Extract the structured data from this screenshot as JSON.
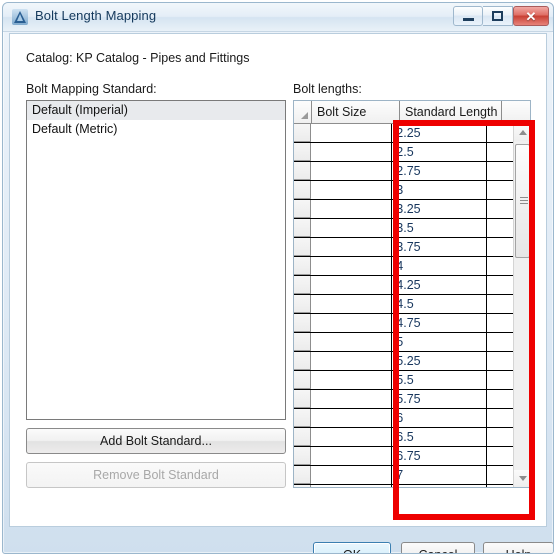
{
  "window": {
    "title": "Bolt Length Mapping",
    "icon": "autocad-triangle-icon",
    "controls": {
      "minimize": "minimize-icon",
      "maximize": "maximize-icon",
      "close": "✕"
    }
  },
  "catalog": {
    "label": "Catalog: KP Catalog - Pipes and Fittings"
  },
  "standards": {
    "label": "Bolt Mapping Standard:",
    "items": [
      {
        "label": "Default (Imperial)",
        "selected": true
      },
      {
        "label": "Default (Metric)",
        "selected": false
      }
    ],
    "add_button": "Add Bolt Standard...",
    "remove_button": "Remove Bolt Standard",
    "remove_enabled": false
  },
  "lengths": {
    "label": "Bolt lengths:",
    "columns": [
      "Bolt Size",
      "Standard Length"
    ],
    "rows": [
      {
        "bolt_size": "",
        "standard_length": "2.25"
      },
      {
        "bolt_size": "",
        "standard_length": "2.5"
      },
      {
        "bolt_size": "",
        "standard_length": "2.75"
      },
      {
        "bolt_size": "",
        "standard_length": "3"
      },
      {
        "bolt_size": "",
        "standard_length": "3.25"
      },
      {
        "bolt_size": "",
        "standard_length": "3.5"
      },
      {
        "bolt_size": "",
        "standard_length": "3.75"
      },
      {
        "bolt_size": "",
        "standard_length": "4"
      },
      {
        "bolt_size": "",
        "standard_length": "4.25"
      },
      {
        "bolt_size": "",
        "standard_length": "4.5"
      },
      {
        "bolt_size": "",
        "standard_length": "4.75"
      },
      {
        "bolt_size": "",
        "standard_length": "5"
      },
      {
        "bolt_size": "",
        "standard_length": "5.25"
      },
      {
        "bolt_size": "",
        "standard_length": "5.5"
      },
      {
        "bolt_size": "",
        "standard_length": "5.75"
      },
      {
        "bolt_size": "",
        "standard_length": "6"
      },
      {
        "bolt_size": "",
        "standard_length": "6.5"
      },
      {
        "bolt_size": "",
        "standard_length": "6.75"
      },
      {
        "bolt_size": "",
        "standard_length": "7"
      },
      {
        "bolt_size": "",
        "standard_length": ""
      }
    ]
  },
  "footer": {
    "ok": "OK",
    "cancel": "Cancel",
    "help": "Help"
  },
  "annotation": {
    "color": "#ee0000",
    "shape": "rectangle-highlight"
  }
}
